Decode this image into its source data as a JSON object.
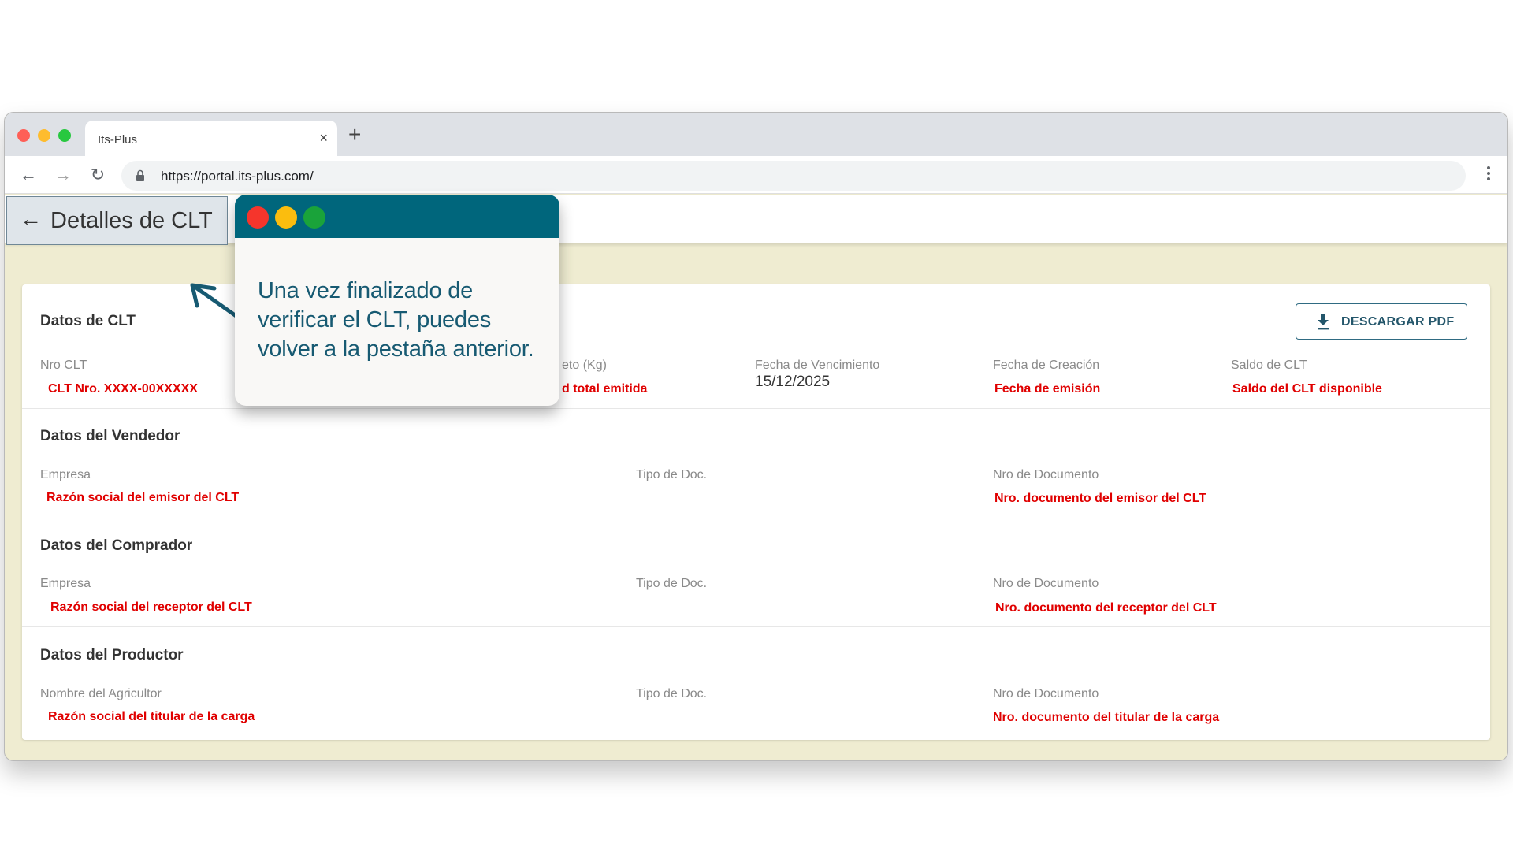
{
  "browser": {
    "tab_title": "Its-Plus",
    "tab_close": "×",
    "new_tab": "+",
    "url": "https://portal.its-plus.com/"
  },
  "app": {
    "back_icon": "←",
    "page_title": "Detalles de CLT",
    "download_button": "DESCARGAR PDF"
  },
  "sections": {
    "clt": {
      "title": "Datos de CLT",
      "nro_label": "Nro CLT",
      "nro_value": "CLT Nro. XXXX-00XXXXX",
      "neto_label": "eto (Kg)",
      "neto_value": "d total emitida",
      "vencimiento_label": "Fecha de Vencimiento",
      "vencimiento_value": "15/12/2025",
      "creacion_label": "Fecha de Creación",
      "creacion_value": "Fecha de emisión",
      "saldo_label": "Saldo de CLT",
      "saldo_value": "Saldo del CLT disponible"
    },
    "vendedor": {
      "title": "Datos del Vendedor",
      "empresa_label": "Empresa",
      "empresa_value": "Razón social del emisor del CLT",
      "tipo_label": "Tipo de Doc.",
      "nro_label": "Nro de Documento",
      "nro_value": "Nro. documento del emisor del CLT"
    },
    "comprador": {
      "title": "Datos del Comprador",
      "empresa_label": "Empresa",
      "empresa_value": "Razón social del receptor del CLT",
      "tipo_label": "Tipo de Doc.",
      "nro_label": "Nro de Documento",
      "nro_value": "Nro. documento del receptor del CLT"
    },
    "productor": {
      "title": "Datos del Productor",
      "nombre_label": "Nombre del Agricultor",
      "nombre_value": "Razón social del titular de la carga",
      "tipo_label": "Tipo de Doc.",
      "nro_label": "Nro de Documento",
      "nro_value": "Nro. documento del titular de la carga"
    }
  },
  "callout": {
    "line1": "Una vez finalizado de",
    "line2": "verificar el CLT, puedes",
    "line3": "volver a la pestaña anterior."
  },
  "colors": {
    "accent": "#00667c",
    "highlight_value": "#e00000",
    "background": "#efecd1"
  }
}
